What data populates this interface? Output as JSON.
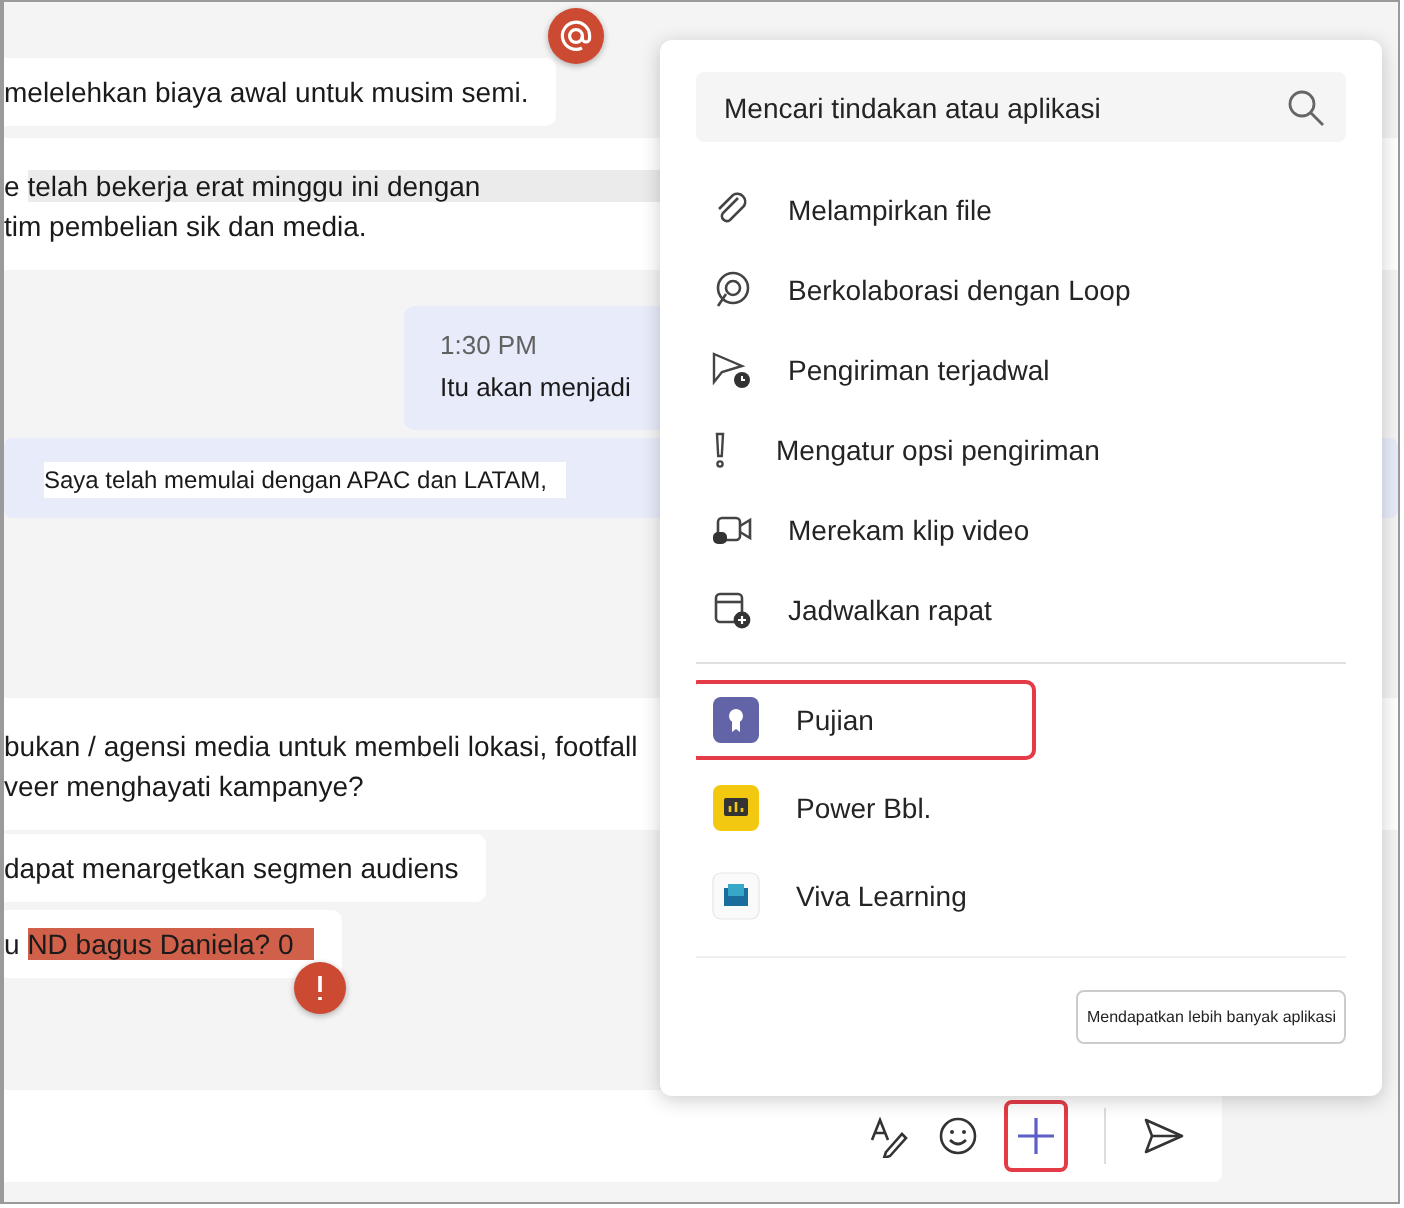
{
  "messages": [
    {
      "kind": "bubble",
      "lines": [
        {
          "text": "melelehkan biaya awal untuk musim semi."
        }
      ]
    },
    {
      "kind": "band",
      "lines": [
        {
          "prefix": "e",
          "text": "telah bekerja erat minggu ini dengan",
          "highlight": true
        },
        {
          "text": "tim pembelian sik dan media."
        }
      ]
    },
    {
      "kind": "outgoing",
      "time": "1:30 PM",
      "lines": [
        {
          "text": "Itu akan menjadi"
        }
      ]
    },
    {
      "kind": "quote",
      "lines": [
        {
          "text": "Saya telah memulai dengan APAC dan LATAM,"
        }
      ]
    },
    {
      "kind": "band",
      "lines": [
        {
          "text": "bukan / agensi media untuk membeli lokasi, footfall"
        },
        {
          "text": "veer menghayati kampanye?"
        }
      ]
    },
    {
      "kind": "bubble",
      "lines": [
        {
          "text": "dapat menargetkan segmen audiens"
        }
      ]
    },
    {
      "kind": "bubble",
      "lines": [
        {
          "prefix": "u",
          "text": "ND bagus Daniela? 0",
          "mark": true
        }
      ]
    }
  ],
  "popup": {
    "search": {
      "placeholder": "Mencari tindakan atau aplikasi"
    },
    "actions": [
      {
        "kind": "clip",
        "label": "Melampirkan file"
      },
      {
        "kind": "loop",
        "label": "Berkolaborasi dengan Loop"
      },
      {
        "kind": "schedule-send",
        "label": "Pengiriman terjadwal"
      },
      {
        "kind": "priority",
        "label": "Mengatur opsi pengiriman"
      },
      {
        "kind": "video",
        "label": "Merekam klip video"
      },
      {
        "kind": "calendar",
        "label": "Jadwalkan rapat"
      }
    ],
    "apps": [
      {
        "kind": "praise",
        "label": "Pujian",
        "selected": true,
        "color": "#6264a7"
      },
      {
        "kind": "chart",
        "label": "Power Bbl.",
        "selected": false,
        "color": "#f2c811"
      },
      {
        "kind": "learning",
        "label": "Viva Learning",
        "selected": false
      }
    ],
    "more_button": "Mendapatkan lebih banyak aplikasi"
  },
  "composer": {
    "plus_selected": true
  }
}
